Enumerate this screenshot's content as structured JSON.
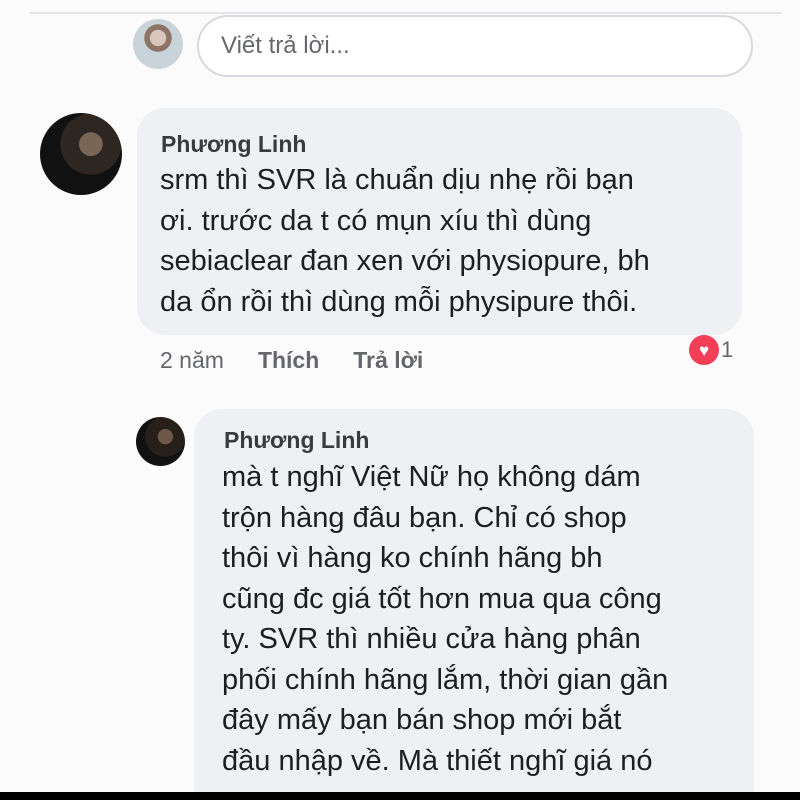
{
  "reply_box": {
    "placeholder": "Viết trả lời..."
  },
  "comments": [
    {
      "author": "Phương Linh",
      "text": "srm thì SVR là chuẩn dịu nhẹ rồi bạn\nơi. trước da t có mụn xíu thì dùng\nsebiaclear đan xen với physiopure, bh\nda ổn rồi thì dùng mỗi physipure thôi.",
      "time": "2 năm",
      "like_label": "Thích",
      "reply_label": "Trả lời",
      "reaction": {
        "icon": "heart-icon",
        "count": "1",
        "color": "#f33e58"
      }
    },
    {
      "author": "Phương Linh",
      "text": "mà t nghĩ Việt Nữ họ không dám\ntrộn hàng đâu bạn. Chỉ có shop\nthôi vì hàng ko chính hãng bh\ncũng đc giá tốt hơn mua qua công\nty. SVR thì nhiều cửa hàng phân\nphối chính hãng lắm, thời gian gần\nđây mấy bạn bán shop mới bắt\nđầu nhập về. Mà thiết nghĩ giá nó"
    }
  ],
  "colors": {
    "bubble_background": "#eef0f3",
    "secondary_text": "#65676b",
    "reaction": "#f33e58"
  }
}
